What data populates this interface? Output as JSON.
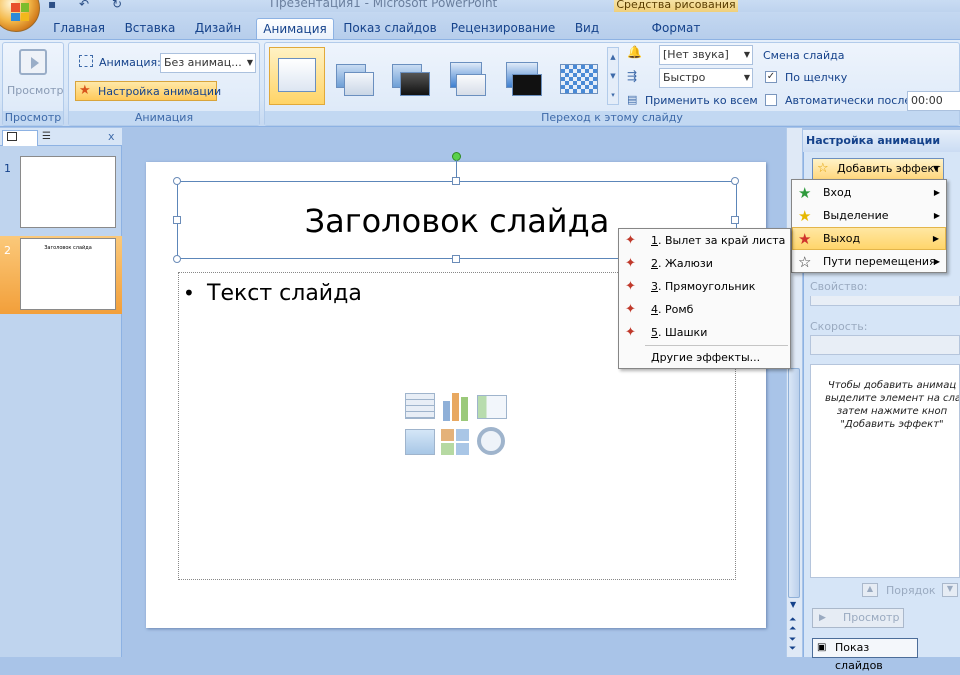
{
  "window": {
    "title": "Презентация1 - Microsoft PowerPoint",
    "context_tab_group": "Средства рисования"
  },
  "tabs": [
    "Главная",
    "Вставка",
    "Дизайн",
    "Анимация",
    "Показ слайдов",
    "Рецензирование",
    "Вид",
    "Формат"
  ],
  "active_tab": "Анимация",
  "ribbon": {
    "preview": {
      "button_label": "Просмотр",
      "group_label": "Просмотр"
    },
    "animation": {
      "animation_label": "Анимация:",
      "animation_value": "Без анимац...",
      "custom_button": "Настройка анимации",
      "group_label": "Анимация"
    },
    "transition": {
      "group_label": "Переход к этому слайду",
      "sound_value": "[Нет звука]",
      "speed_value": "Быстро",
      "apply_all": "Применить ко всем",
      "advance_title": "Смена слайда",
      "on_click_label": "По щелчку",
      "on_click_checked": true,
      "auto_after_label": "Автоматически после:",
      "auto_after_checked": false,
      "auto_after_value": "00:00"
    }
  },
  "slides_panel": {
    "slide_numbers": [
      "1",
      "2"
    ],
    "slide2_title": "Заголовок слайда",
    "close_glyph": "x"
  },
  "slide": {
    "title": "Заголовок слайда",
    "bullet": "•",
    "body_text": "Текст слайда"
  },
  "task_pane": {
    "title": "Настройка анимации",
    "add_effect_label": "Добавить эффект",
    "property_label": "Свойство:",
    "speed_label": "Скорость:",
    "info_lines": [
      "Чтобы добавить анимац",
      "выделите элемент на сла",
      "затем нажмите кноп",
      "\"Добавить эффект\""
    ],
    "order_label": "Порядок",
    "preview_label": "Просмотр",
    "slideshow_label": "Показ слайдов"
  },
  "effect_menu": {
    "items": [
      {
        "label": "Вход",
        "icon": "green-star-icon",
        "highlighted": false
      },
      {
        "label": "Выделение",
        "icon": "yellow-star-icon",
        "highlighted": false
      },
      {
        "label": "Выход",
        "icon": "red-star-icon",
        "highlighted": true
      },
      {
        "label": "Пути перемещения",
        "icon": "outline-star-icon",
        "highlighted": false
      }
    ]
  },
  "exit_submenu": {
    "items": [
      {
        "num": "1",
        "label": ". Вылет за край листа"
      },
      {
        "num": "2",
        "label": ". Жалюзи"
      },
      {
        "num": "3",
        "label": ". Прямоугольник"
      },
      {
        "num": "4",
        "label": ". Ромб"
      },
      {
        "num": "5",
        "label": ". Шашки"
      }
    ],
    "more": "Другие эффекты..."
  }
}
